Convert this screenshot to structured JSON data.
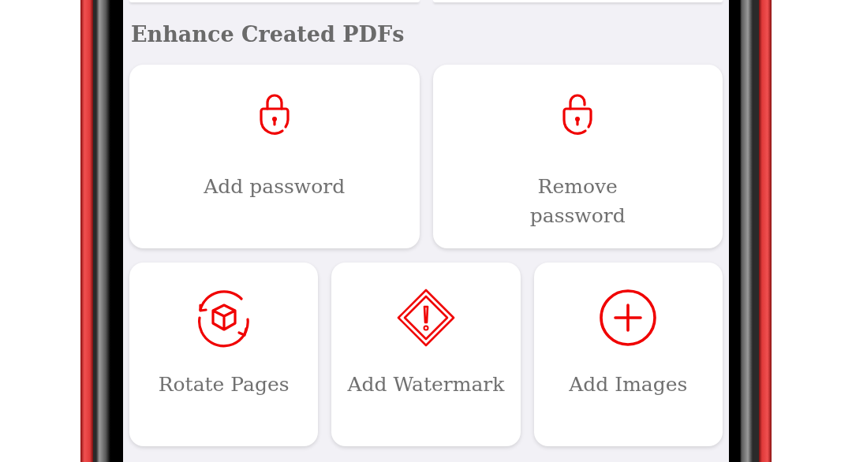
{
  "section": {
    "title": "Enhance Created PDFs"
  },
  "rows": [
    [
      {
        "kind": "lock",
        "label": "Add password"
      },
      {
        "kind": "unlock",
        "label": "Remove password"
      }
    ],
    [
      {
        "kind": "rotate",
        "label": "Rotate Pages"
      },
      {
        "kind": "warning",
        "label": "Add Watermark"
      },
      {
        "kind": "plus",
        "label": "Add Images"
      }
    ]
  ]
}
